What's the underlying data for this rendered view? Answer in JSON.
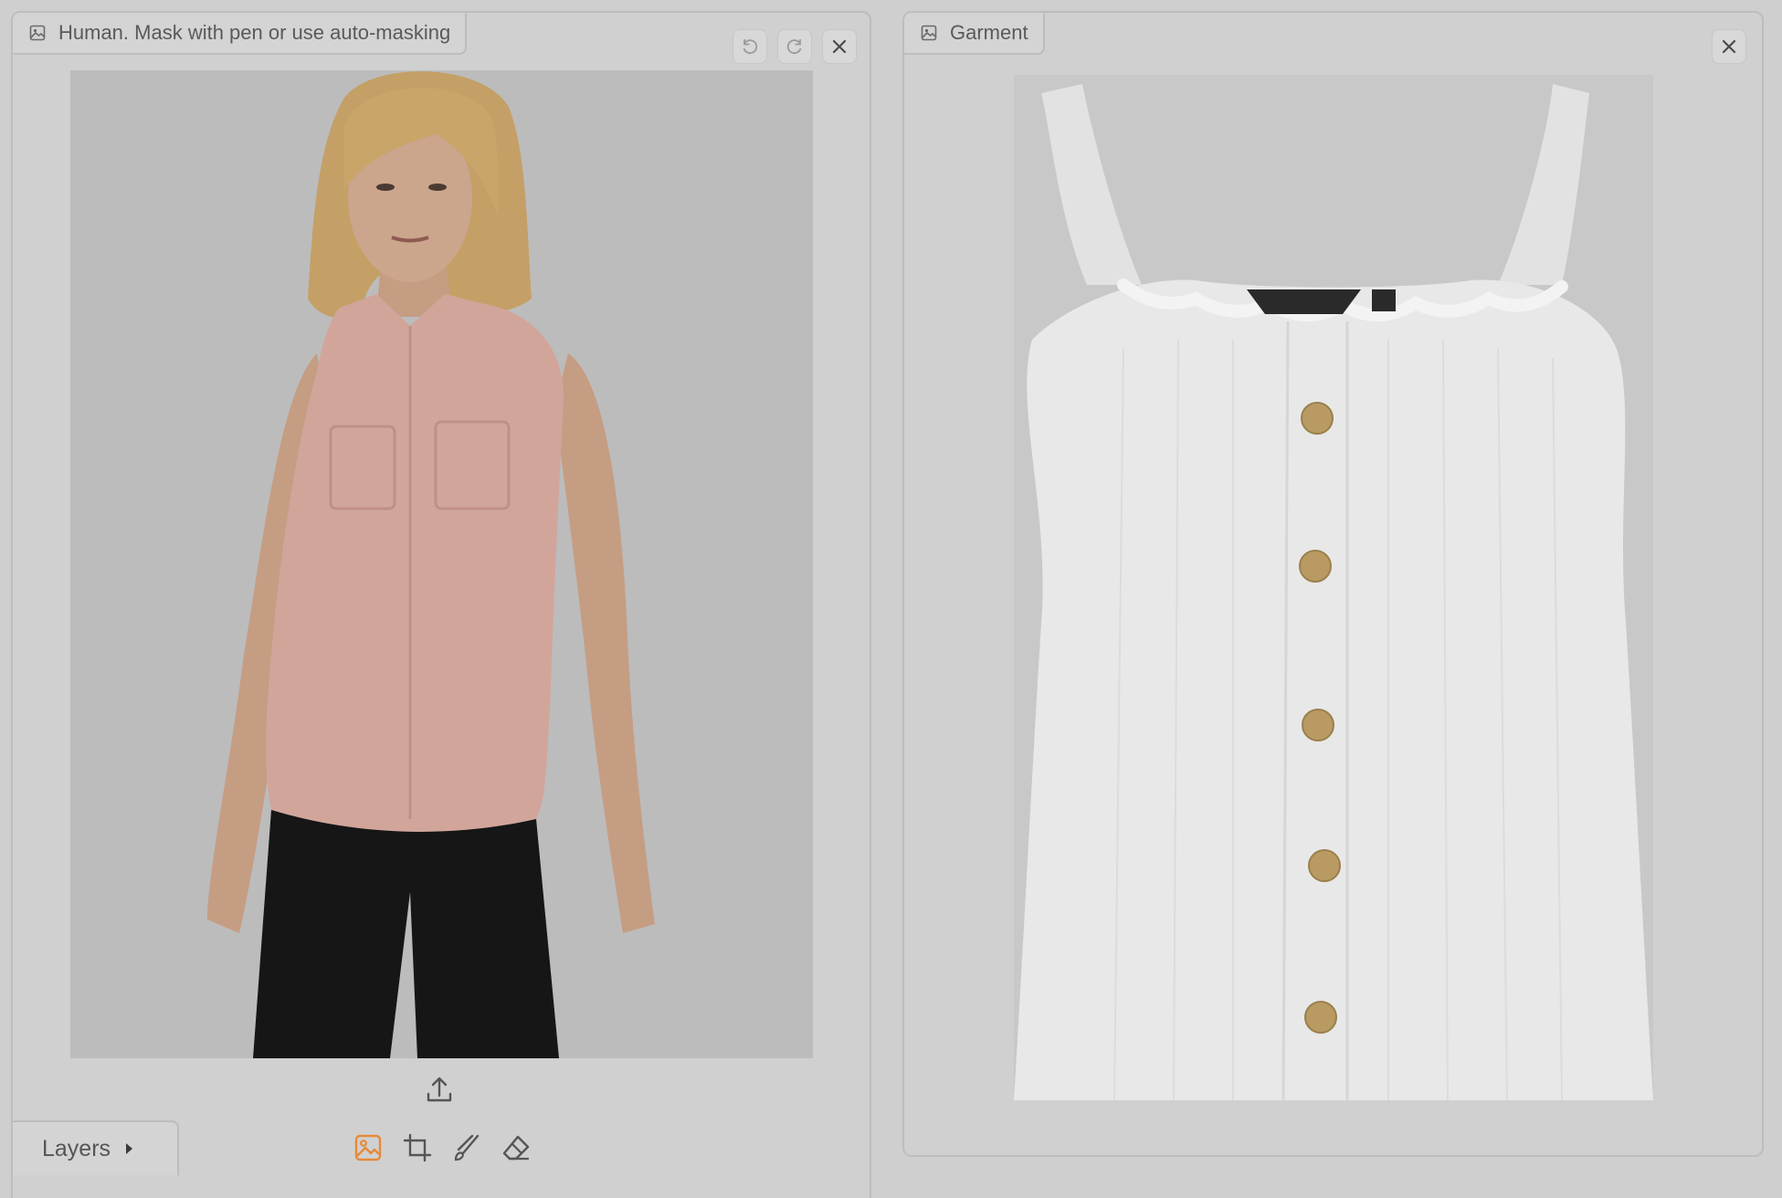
{
  "human_panel": {
    "label": "Human. Mask with pen or use auto-masking",
    "layers_label": "Layers",
    "tools": [
      "image-tool",
      "crop-tool",
      "brush-tool",
      "eraser-tool"
    ],
    "active_tool": "image-tool"
  },
  "garment_panel": {
    "label": "Garment"
  },
  "colors": {
    "accent": "#e58a3a",
    "shirt": "#d2a59b",
    "pants": "#151515",
    "skin": "#caa38a",
    "hair": "#c9a56a",
    "garment": "#e8e8e8",
    "button": "#b89a62"
  },
  "icons": {
    "image": "image-icon",
    "undo": "undo-icon",
    "redo": "redo-icon",
    "close": "close-icon",
    "upload": "upload-icon",
    "caret": "caret-right-icon"
  }
}
